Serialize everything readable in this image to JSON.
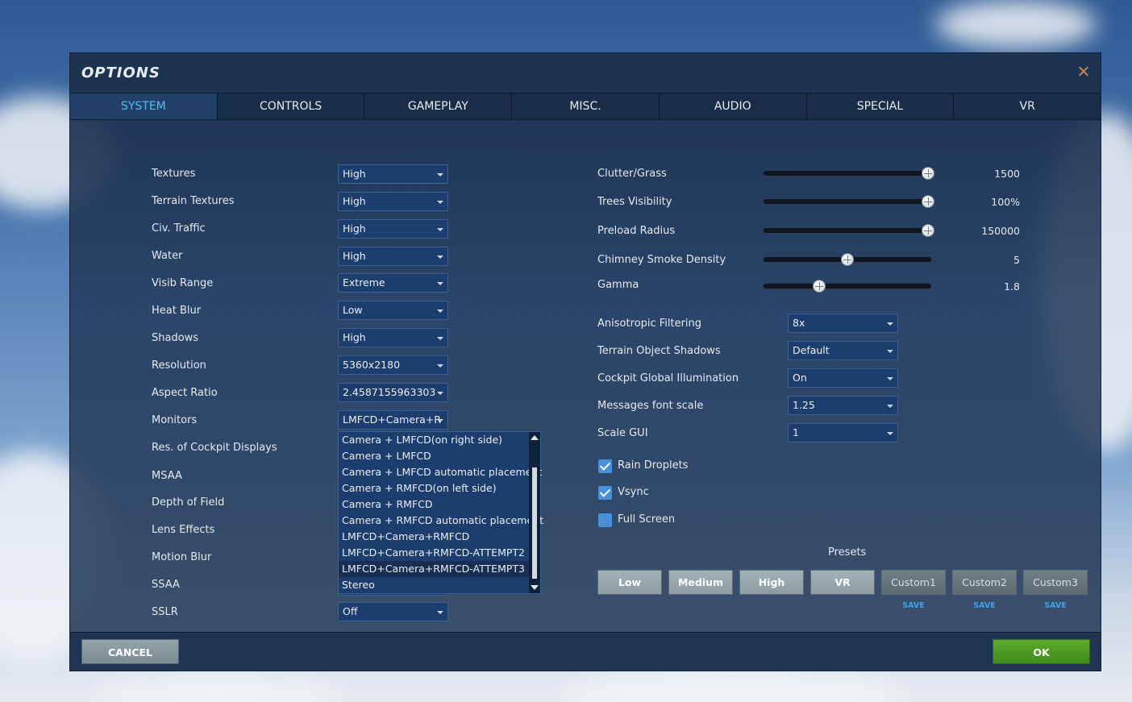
{
  "window": {
    "title": "OPTIONS"
  },
  "tabs": [
    {
      "label": "SYSTEM",
      "active": true
    },
    {
      "label": "CONTROLS"
    },
    {
      "label": "GAMEPLAY"
    },
    {
      "label": "MISC."
    },
    {
      "label": "AUDIO"
    },
    {
      "label": "SPECIAL"
    },
    {
      "label": "VR"
    }
  ],
  "left_settings": [
    {
      "label": "Textures",
      "value": "High"
    },
    {
      "label": "Terrain Textures",
      "value": "High"
    },
    {
      "label": "Civ. Traffic",
      "value": "High"
    },
    {
      "label": "Water",
      "value": "High"
    },
    {
      "label": "Visib Range",
      "value": "Extreme"
    },
    {
      "label": "Heat Blur",
      "value": "Low"
    },
    {
      "label": "Shadows",
      "value": "High"
    },
    {
      "label": "Resolution",
      "value": "5360x2180"
    },
    {
      "label": "Aspect Ratio",
      "value": "2.4587155963303"
    },
    {
      "label": "Monitors",
      "value": "LMFCD+Camera+R"
    },
    {
      "label": "Res. of Cockpit Displays"
    },
    {
      "label": "MSAA"
    },
    {
      "label": "Depth of Field"
    },
    {
      "label": "Lens Effects"
    },
    {
      "label": "Motion Blur"
    },
    {
      "label": "SSAA"
    },
    {
      "label": "SSLR",
      "value": "Off"
    }
  ],
  "monitors_dropdown": {
    "options": [
      "Camera + LMFCD(on right side)",
      "Camera + LMFCD",
      "Camera + LMFCD automatic placement",
      "Camera + RMFCD(on left side)",
      "Camera + RMFCD",
      "Camera + RMFCD automatic placement",
      "LMFCD+Camera+RMFCD",
      "LMFCD+Camera+RMFCD-ATTEMPT2",
      "LMFCD+Camera+RMFCD-ATTEMPT3",
      "Stereo"
    ],
    "highlighted_index": 8
  },
  "sliders": [
    {
      "label": "Clutter/Grass",
      "value": "1500",
      "fraction": 0.98
    },
    {
      "label": "Trees Visibility",
      "value": "100%",
      "fraction": 0.98
    },
    {
      "label": "Preload Radius",
      "value": "150000",
      "fraction": 0.98
    },
    {
      "label": "Chimney Smoke Density",
      "value": "5",
      "fraction": 0.5
    },
    {
      "label": "Gamma",
      "value": "1.8",
      "fraction": 0.33
    }
  ],
  "right_settings": [
    {
      "label": "Anisotropic Filtering",
      "value": "8x"
    },
    {
      "label": "Terrain Object Shadows",
      "value": "Default"
    },
    {
      "label": "Cockpit Global Illumination",
      "value": "On"
    },
    {
      "label": "Messages font scale",
      "value": "1.25"
    },
    {
      "label": "Scale GUI",
      "value": "1"
    }
  ],
  "checkboxes": [
    {
      "label": "Rain Droplets",
      "checked": true
    },
    {
      "label": "Vsync",
      "checked": true
    },
    {
      "label": "Full Screen",
      "checked": false
    }
  ],
  "presets": {
    "title": "Presets",
    "buttons": [
      "Low",
      "Medium",
      "High",
      "VR",
      "Custom1",
      "Custom2",
      "Custom3"
    ],
    "save_label": "SAVE"
  },
  "footer": {
    "cancel_label": "CANCEL",
    "ok_label": "OK"
  }
}
